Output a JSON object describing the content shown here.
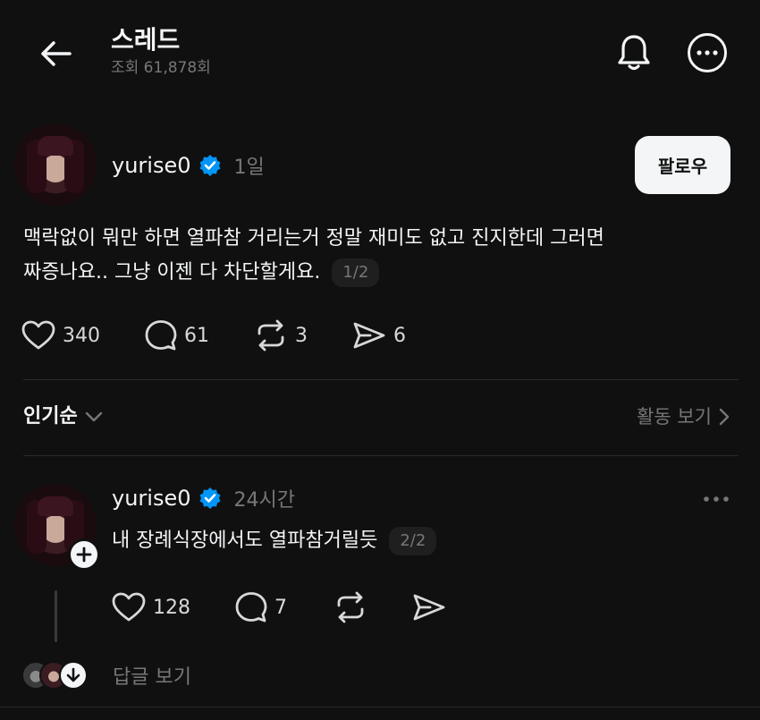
{
  "header": {
    "title": "스레드",
    "views": "조회 61,878회",
    "back_icon": "arrow-left-icon",
    "bell_icon": "bell-icon",
    "more_icon": "more-circle-icon"
  },
  "post": {
    "username": "yurise0",
    "verified": true,
    "time": "1일",
    "follow_label": "팔로우",
    "text_line1": "맥락없이 뭐만 하면 열파참 거리는거 정말 재미도 없고 진지한데 그러면",
    "text_line2": "짜증나요.. 그냥 이젠 다 차단할게요.",
    "page": "1/2",
    "likes": "340",
    "comments": "61",
    "reposts": "3",
    "shares": "6"
  },
  "sort": {
    "label": "인기순",
    "activity_label": "활동 보기"
  },
  "reply": {
    "username": "yurise0",
    "verified": true,
    "time": "24시간",
    "text": "내 장례식장에서도 열파참거릴듯",
    "page": "2/2",
    "likes": "128",
    "comments": "7",
    "view_replies_label": "답글 보기"
  },
  "colors": {
    "background": "#101010",
    "text": "#f3f5f7",
    "muted": "#777777",
    "verified": "#0095f6"
  }
}
